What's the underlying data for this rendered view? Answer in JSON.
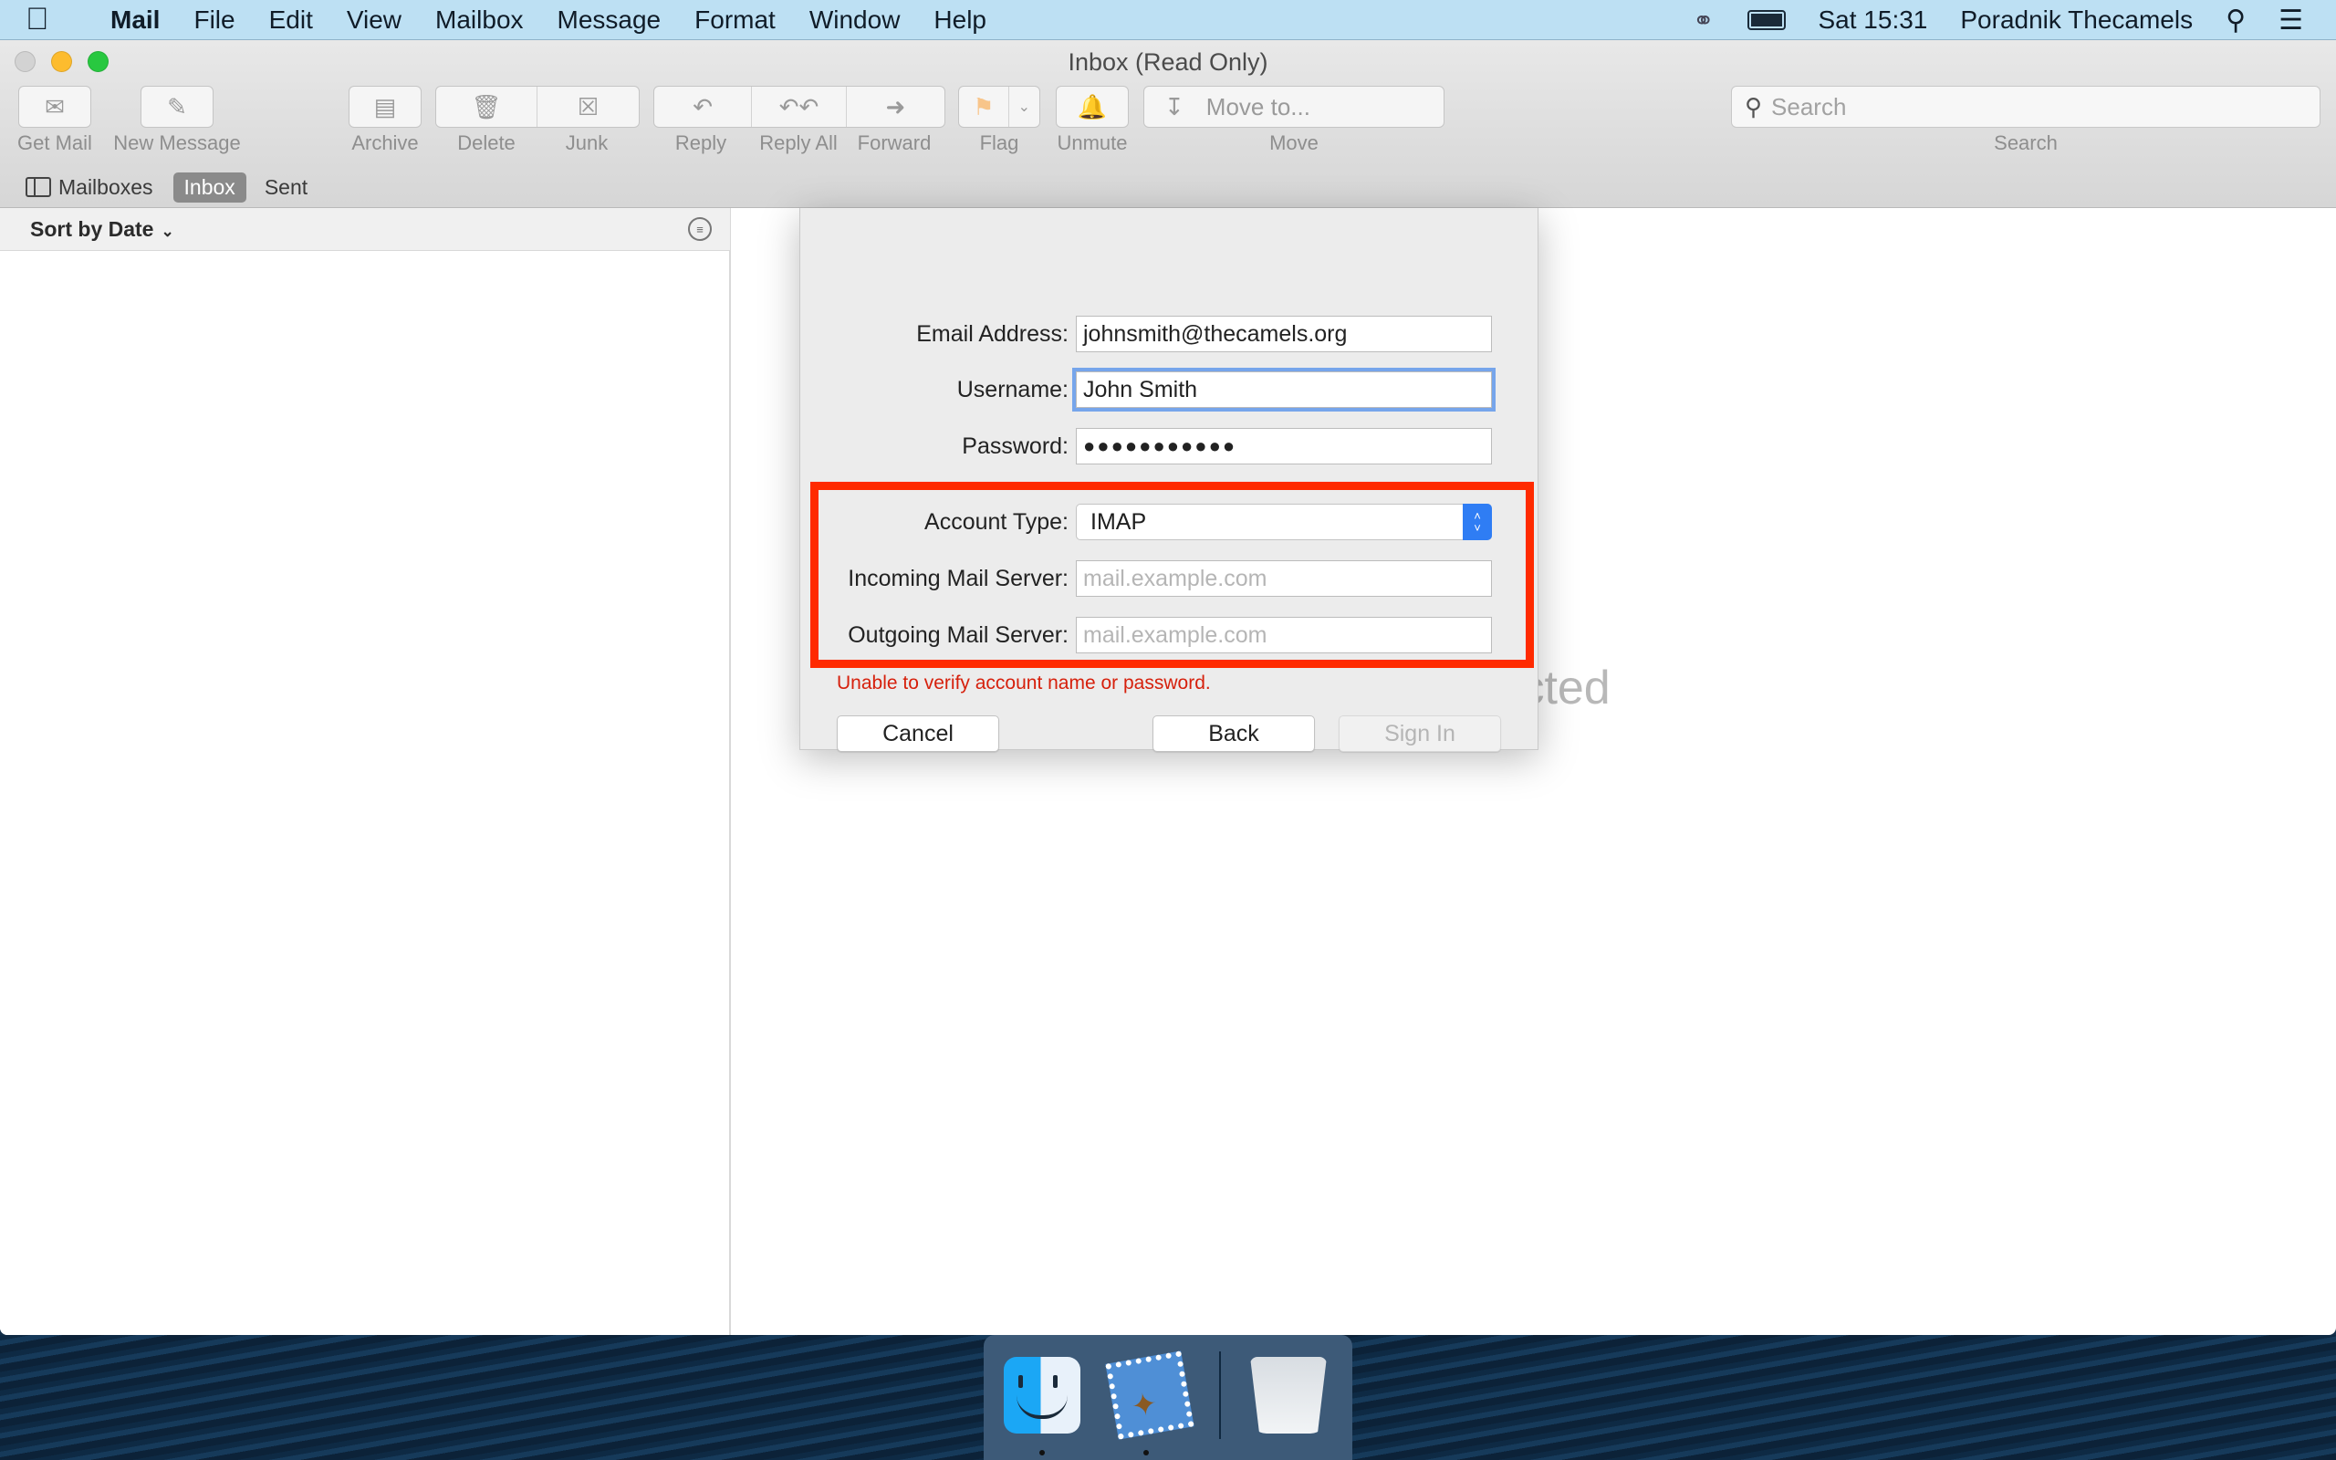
{
  "menubar": {
    "apple_icon": "apple-logo-icon",
    "app_name": "Mail",
    "items": [
      "File",
      "Edit",
      "View",
      "Mailbox",
      "Message",
      "Format",
      "Window",
      "Help"
    ],
    "clock": "Sat 15:31",
    "user": "Poradnik Thecamels"
  },
  "window": {
    "title": "Inbox (Read Only)",
    "toolbar": {
      "get_mail": "Get Mail",
      "new_message": "New Message",
      "archive": "Archive",
      "delete": "Delete",
      "junk": "Junk",
      "reply": "Reply",
      "reply_all": "Reply All",
      "forward": "Forward",
      "flag": "Flag",
      "unmute": "Unmute",
      "move_placeholder": "Move to...",
      "move": "Move",
      "search_placeholder": "Search",
      "search": "Search"
    },
    "tabs": {
      "mailboxes": "Mailboxes",
      "inbox": "Inbox",
      "sent": "Sent"
    },
    "sort_label": "Sort by Date",
    "no_message": "No Message Selected"
  },
  "dialog": {
    "email_label": "Email Address:",
    "email_value": "johnsmith@thecamels.org",
    "username_label": "Username:",
    "username_value": "John Smith",
    "password_label": "Password:",
    "password_value": "●●●●●●●●●●●",
    "account_type_label": "Account Type:",
    "account_type_value": "IMAP",
    "incoming_label": "Incoming Mail Server:",
    "incoming_placeholder": "mail.example.com",
    "outgoing_label": "Outgoing Mail Server:",
    "outgoing_placeholder": "mail.example.com",
    "error": "Unable to verify account name or password.",
    "cancel": "Cancel",
    "back": "Back",
    "sign_in": "Sign In",
    "highlight_color": "#ff2a00",
    "error_color": "#d6200c"
  },
  "dock": {
    "apps": [
      "Finder",
      "Mail",
      "Trash"
    ]
  }
}
